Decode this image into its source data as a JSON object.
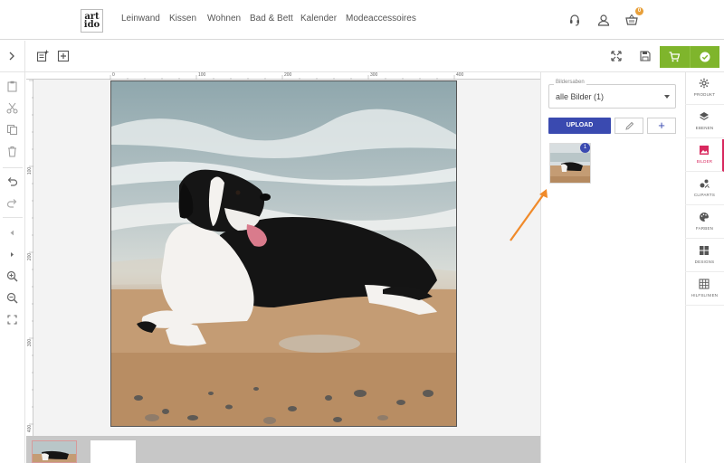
{
  "logo": {
    "line1": "art",
    "line2": "ido"
  },
  "nav": [
    "Leinwand",
    "Kissen",
    "Wohnen",
    "Bad & Bett",
    "Kalender",
    "Modeaccessoires"
  ],
  "top_icons": {
    "support": "headset-icon",
    "account": "user-icon",
    "basket": "basket-icon",
    "basket_count": "0"
  },
  "toolbar": {
    "icons": [
      "chevron-right-icon",
      "add-page-icon",
      "add-box-icon",
      "fullscreen-icon",
      "save-icon",
      "cart-icon",
      "check-icon"
    ],
    "accent": "#7fb52c"
  },
  "left_tools": [
    "clipboard-icon",
    "scissors-icon",
    "copy-icon",
    "trash-icon",
    "undo-icon",
    "redo-icon",
    "arrow-left-icon",
    "arrow-right-icon",
    "zoom-in-icon",
    "zoom-out-icon",
    "fit-screen-icon"
  ],
  "ruler": {
    "top": [
      "0",
      "100",
      "200",
      "300",
      "400"
    ],
    "left": [
      "100",
      "200",
      "300",
      "400"
    ]
  },
  "panel": {
    "select_label": "Bildersaben",
    "select_value": "alle Bilder (1)",
    "upload_label": "UPLOAD",
    "add_label": "+",
    "thumb_badge": "1",
    "accent": "#3a4ab0"
  },
  "tabs": [
    {
      "label": "PRODUKT",
      "icon": "gear-icon"
    },
    {
      "label": "EBENEN",
      "icon": "layers-icon"
    },
    {
      "label": "BILDER",
      "icon": "image-icon",
      "active": true
    },
    {
      "label": "CLIPARTS",
      "icon": "clipart-icon"
    },
    {
      "label": "FARBEN",
      "icon": "palette-icon"
    },
    {
      "label": "DESIGNS",
      "icon": "designs-icon"
    },
    {
      "label": "HILFSLINIEN",
      "icon": "grid-icon"
    }
  ],
  "active_color": "#d8285e"
}
